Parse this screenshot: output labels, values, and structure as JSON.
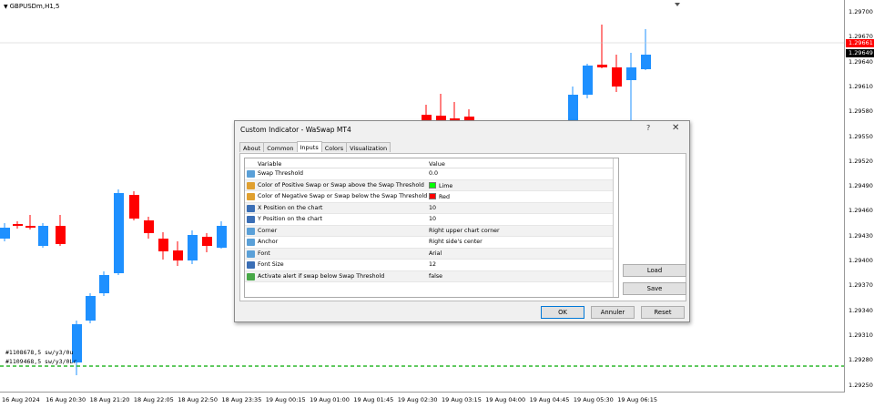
{
  "chart": {
    "symbol": "GBPUSDm,H1,5",
    "colors": {
      "bull": "#1e90ff",
      "bear": "#ff0000",
      "dashed": "#00aa00"
    },
    "price_ticks": [
      "1.29700",
      "1.29670",
      "1.29640",
      "1.29610",
      "1.29580",
      "1.29550",
      "1.29520",
      "1.29490",
      "1.29460",
      "1.29430",
      "1.29400",
      "1.29370",
      "1.29340",
      "1.29310",
      "1.29280",
      "1.29250"
    ],
    "price_tag_upper": "1.29661",
    "price_tag_lower": "1.29649",
    "time_ticks": [
      "16 Aug 2024",
      "16 Aug 20:30",
      "18 Aug 21:20",
      "18 Aug 22:05",
      "18 Aug 22:50",
      "18 Aug 23:35",
      "19 Aug 00:15",
      "19 Aug 01:00",
      "19 Aug 01:45",
      "19 Aug 02:30",
      "19 Aug 03:15",
      "19 Aug 04:00",
      "19 Aug 04:45",
      "19 Aug 05:30",
      "19 Aug 06:15"
    ],
    "overlay_line1": "#1108678,5 sw/y3/0u",
    "overlay_line2": "#1109468,5 sw/y3/0Lr"
  },
  "dialog": {
    "title": "Custom Indicator - WaSwap MT4",
    "help": "?",
    "close": "✕",
    "tabs": [
      "About",
      "Common",
      "Inputs",
      "Colors",
      "Visualization"
    ],
    "active_tab": "Inputs",
    "columns": {
      "variable": "Variable",
      "value": "Value"
    },
    "rows": [
      {
        "variable": "Swap Threshold",
        "value": "0.0",
        "icon": "#5aa0d8"
      },
      {
        "variable": "Color of Positive Swap or Swap above the Swap Threshold",
        "value": "Lime",
        "swatch": "#00ff00",
        "icon": "#e0a030"
      },
      {
        "variable": "Color of Negative Swap or Swap below the Swap Threshold",
        "value": "Red",
        "swatch": "#ff0000",
        "icon": "#e0a030"
      },
      {
        "variable": "X Position on the chart",
        "value": "10",
        "icon": "#3b6fb6"
      },
      {
        "variable": "Y Position on the chart",
        "value": "10",
        "icon": "#3b6fb6"
      },
      {
        "variable": "Corner",
        "value": "Right upper chart corner",
        "icon": "#5aa0d8"
      },
      {
        "variable": "Anchor",
        "value": "Right side's center",
        "icon": "#5aa0d8"
      },
      {
        "variable": "Font",
        "value": "Arial",
        "icon": "#5aa0d8"
      },
      {
        "variable": "Font Size",
        "value": "12",
        "icon": "#3b6fb6"
      },
      {
        "variable": "Activate alert if swap below Swap Threshold",
        "value": "false",
        "icon": "#48a848"
      }
    ],
    "load_label": "Load",
    "save_label": "Save",
    "ok_label": "OK",
    "cancel_label": "Annuler",
    "reset_label": "Reset"
  }
}
